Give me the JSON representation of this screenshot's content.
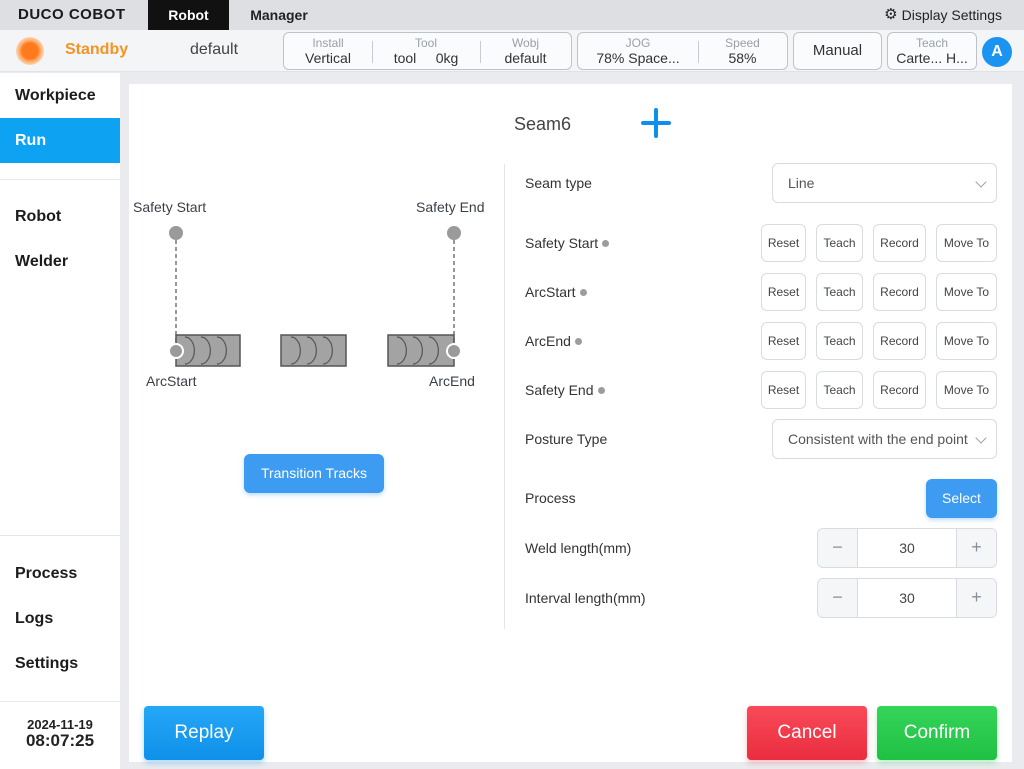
{
  "topbar": {
    "logo": "DUCO COBOT",
    "tabs": [
      "Robot",
      "Manager"
    ],
    "display_settings": "Display Settings"
  },
  "status": {
    "state": "Standby",
    "project": "default",
    "install": {
      "caption": "Install",
      "value": "Vertical"
    },
    "tool": {
      "caption": "Tool",
      "name": "tool",
      "load": "0kg"
    },
    "wobj": {
      "caption": "Wobj",
      "value": "default"
    },
    "jog": {
      "caption": "JOG",
      "value": "78%  Space..."
    },
    "speed": {
      "caption": "Speed",
      "value": "58%"
    },
    "mode": "Manual",
    "teach": {
      "caption": "Teach",
      "value": "Carte... H..."
    },
    "user_initial": "A",
    "led_color": "#ff7a1c"
  },
  "sidebar": {
    "items": [
      "Workpiece",
      "Run",
      "Robot",
      "Welder",
      "Process",
      "Logs",
      "Settings"
    ],
    "active": "Run",
    "date": "2024-11-19",
    "time": "08:07:25"
  },
  "seam": {
    "title": "Seam6",
    "diagram": {
      "safety_start": "Safety Start",
      "safety_end": "Safety End",
      "arc_start": "ArcStart",
      "arc_end": "ArcEnd"
    },
    "transition_button": "Transition Tracks"
  },
  "form": {
    "seam_type": {
      "label": "Seam type",
      "value": "Line"
    },
    "points": [
      {
        "label": "Safety Start"
      },
      {
        "label": "ArcStart"
      },
      {
        "label": "ArcEnd"
      },
      {
        "label": "Safety End"
      }
    ],
    "point_buttons": {
      "reset": "Reset",
      "teach": "Teach",
      "record": "Record",
      "move_to": "Move To"
    },
    "posture_type": {
      "label": "Posture Type",
      "value": "Consistent with the end point"
    },
    "process": {
      "label": "Process",
      "button": "Select"
    },
    "weld_length": {
      "label": "Weld length(mm)",
      "value": "30"
    },
    "interval_length": {
      "label": "Interval length(mm)",
      "value": "30"
    },
    "stepper_minus": "−",
    "stepper_plus": "+"
  },
  "actions": {
    "replay": "Replay",
    "cancel": "Cancel",
    "confirm": "Confirm"
  },
  "colors": {
    "accent": "#0ea3f2",
    "primary_button": "#3d9bf2",
    "cancel": "#ea2d3f",
    "confirm": "#1fc143",
    "state": "#f39425"
  }
}
